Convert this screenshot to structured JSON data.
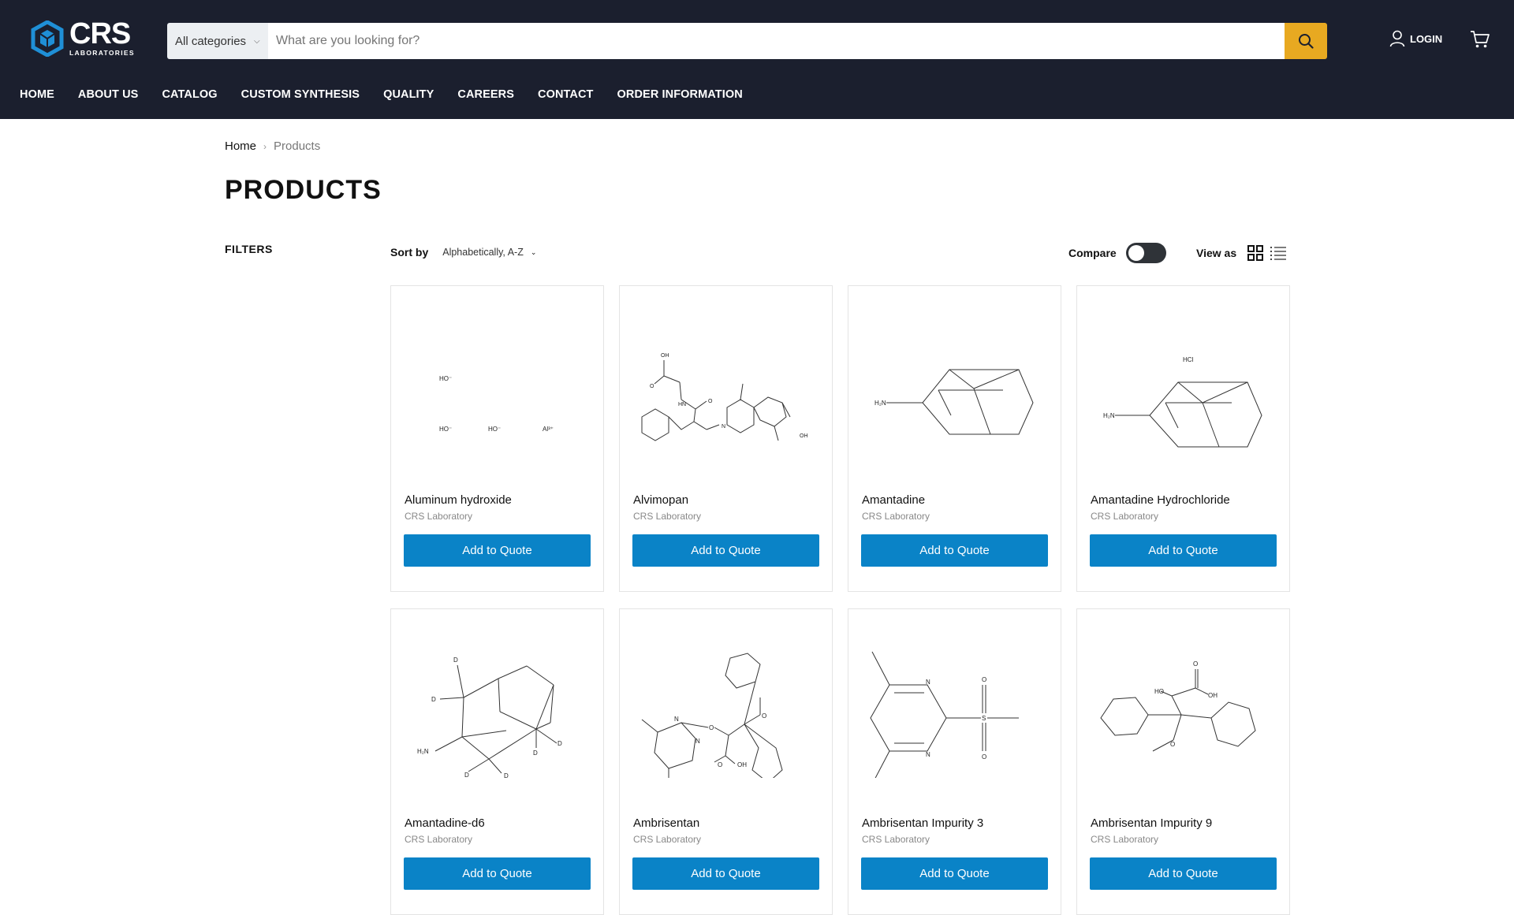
{
  "brand": {
    "logo_text": "CRS",
    "logo_sub": "LABORATORIES",
    "accent": "#e8a921",
    "button_color": "#0a83c7",
    "header_bg": "#1b1f2e"
  },
  "search": {
    "category": "All categories",
    "placeholder": "What are you looking for?"
  },
  "account": {
    "login_label": "LOGIN"
  },
  "nav": {
    "items": [
      "HOME",
      "ABOUT US",
      "CATALOG",
      "CUSTOM SYNTHESIS",
      "QUALITY",
      "CAREERS",
      "CONTACT",
      "ORDER INFORMATION"
    ]
  },
  "breadcrumb": {
    "home": "Home",
    "current": "Products"
  },
  "page": {
    "title": "PRODUCTS",
    "filters_label": "FILTERS"
  },
  "toolbar": {
    "sort_label": "Sort by",
    "sort_value": "Alphabetically, A-Z",
    "compare_label": "Compare",
    "view_label": "View as"
  },
  "products": [
    {
      "name": "Aluminum hydroxide",
      "vendor": "CRS Laboratory",
      "button": "Add to Quote"
    },
    {
      "name": "Alvimopan",
      "vendor": "CRS Laboratory",
      "button": "Add to Quote"
    },
    {
      "name": "Amantadine",
      "vendor": "CRS Laboratory",
      "button": "Add to Quote"
    },
    {
      "name": "Amantadine Hydrochloride",
      "vendor": "CRS Laboratory",
      "button": "Add to Quote"
    },
    {
      "name": "Amantadine-d6",
      "vendor": "CRS Laboratory",
      "button": "Add to Quote"
    },
    {
      "name": "Ambrisentan",
      "vendor": "CRS Laboratory",
      "button": "Add to Quote"
    },
    {
      "name": "Ambrisentan Impurity 3",
      "vendor": "CRS Laboratory",
      "button": "Add to Quote"
    },
    {
      "name": "Ambrisentan Impurity 9",
      "vendor": "CRS Laboratory",
      "button": "Add to Quote"
    }
  ],
  "structure_labels": {
    "aluminum": [
      "HO⁻",
      "HO⁻",
      "HO⁻",
      "Al³⁺"
    ],
    "alvimopan": [
      "OH",
      "O",
      "HN",
      "O",
      "N",
      "OH"
    ],
    "amantadine": [
      "H₂N"
    ],
    "amantadine_hcl": [
      "HCl",
      "H₂N"
    ],
    "amantadine_d6": [
      "D",
      "D",
      "H₂N",
      "D",
      "D",
      "D",
      "D"
    ],
    "ambrisentan": [
      "N",
      "N",
      "O",
      "O",
      "O",
      "OH"
    ],
    "impurity3": [
      "N",
      "N",
      "O",
      "S",
      "O"
    ],
    "impurity9": [
      "HO",
      "O",
      "OH",
      "O"
    ]
  }
}
